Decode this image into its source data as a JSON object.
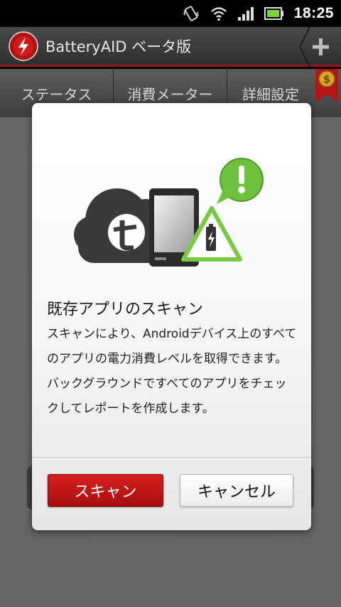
{
  "status_bar": {
    "time": "18:25",
    "icons": [
      "vibrate-icon",
      "wifi-icon",
      "signal-icon",
      "battery-icon"
    ]
  },
  "app_bar": {
    "title": "BatteryAID ベータ版",
    "logo_icon": "batteryaid-logo-icon",
    "add_icon": "plus-icon"
  },
  "tabs": [
    {
      "label": "ステータス"
    },
    {
      "label": "消費メーター"
    },
    {
      "label": "詳細設定"
    }
  ],
  "badge_icon": "dollar-coin-icon",
  "dialog": {
    "heading": "既存アプリのスキャン",
    "body": "スキャンにより、Androidデバイス上のすべてのアプリの電力消費レベルを取得できます。バックグラウンドですべてのアプリをチェックしてレポートを作成します。",
    "scan_button": "スキャン",
    "cancel_button": "キャンセル",
    "colors": {
      "scan_button": "#c41616",
      "accent_green": "#7ac943",
      "title_bar_border": "#9a1010"
    }
  }
}
